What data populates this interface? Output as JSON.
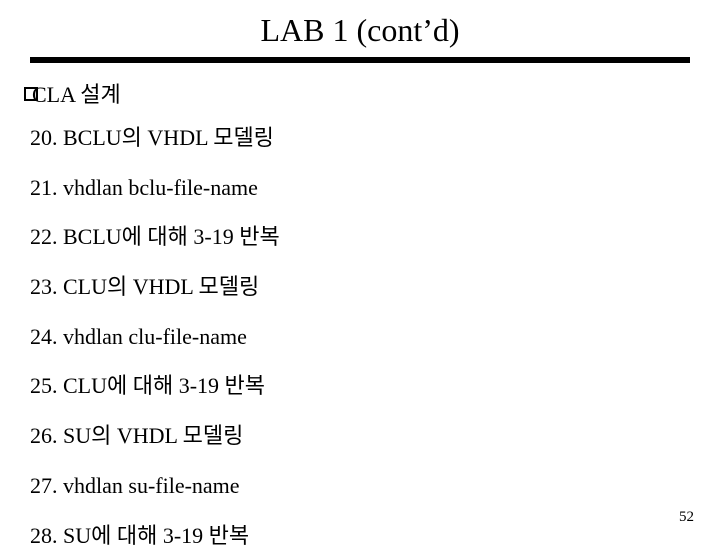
{
  "title": "LAB 1 (cont’d)",
  "bullet": {
    "icon": "square-outline",
    "text": "CLA 설계"
  },
  "items": [
    "20. BCLU의 VHDL 모델링",
    "21. vhdlan bclu-file-name",
    "22. BCLU에 대해 3-19 반복",
    "23. CLU의 VHDL 모델링",
    "24. vhdlan clu-file-name",
    "25. CLU에 대해 3-19 반복",
    "26. SU의 VHDL 모델링",
    "27. vhdlan su-file-name",
    "28. SU에 대해 3-19 반복"
  ],
  "page_number": "52"
}
